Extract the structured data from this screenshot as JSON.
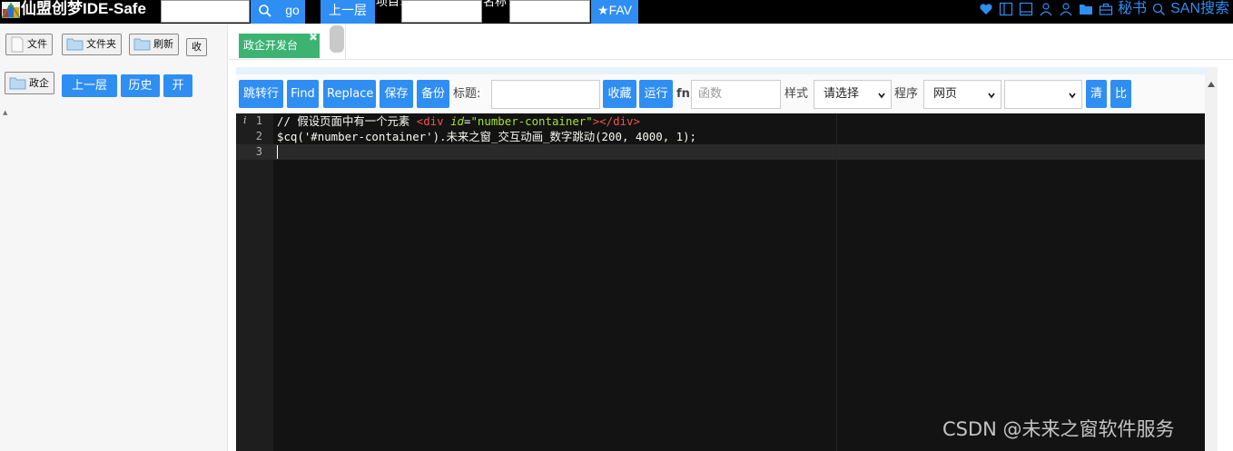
{
  "topbar": {
    "app_title": "仙盟创梦IDE-Safe",
    "search_value": "",
    "go_label": "go",
    "up_level_label": "上一层",
    "project_label": "项目:",
    "project_value": "",
    "name_label": "名称",
    "name_value": "",
    "fav_label": "★FAV",
    "secretary_label": "秘书",
    "san_search_label": "SAN搜索",
    "icons": [
      "heart-icon",
      "panel-left-icon",
      "panel-bottom-icon",
      "user-icon",
      "user-outline-icon",
      "folder-icon",
      "briefcase-icon"
    ]
  },
  "left_panel": {
    "file_label": "文件",
    "folder_label": "文件夹",
    "refresh_label": "刷新",
    "collapse_label": "收",
    "current_folder_label": "政企",
    "up_label": "上一层",
    "history_label": "历史",
    "open_label": "开"
  },
  "tabs": [
    {
      "label": "政企开发台",
      "active": true,
      "close": "✖"
    }
  ],
  "toolbar": {
    "goto_line_label": "跳转行",
    "find_label": "Find",
    "replace_label": "Replace",
    "save_label": "保存",
    "backup_label": "备份",
    "title_label": "标题:",
    "title_value": "",
    "collect_label": "收藏",
    "run_label": "运行",
    "fn_label": "fn",
    "function_placeholder": "函数",
    "style_label": "样式",
    "style_select_value": "请选择",
    "program_label": "程序",
    "program_select_value": "网页",
    "extra_select_value": "",
    "clear_label": "清",
    "compare_label": "比"
  },
  "editor": {
    "gutter_info": "i",
    "line_numbers": [
      "1",
      "2",
      "3"
    ],
    "line1": {
      "comment": "// 假设页面中有一个元素 ",
      "tag_open": "<div",
      "attr_name": "id",
      "eq": "=",
      "attr_value": "\"number-container\"",
      "tag_close": "></div>"
    },
    "line2": "$cq('#number-container').未来之窗_交互动画_数字跳动(200, 4000, 1);",
    "line3": ""
  },
  "watermark": "CSDN @未来之窗软件服务",
  "colors": {
    "accent": "#2f8ef2",
    "tab_active": "#3cb371",
    "editor_bg": "#131313",
    "html_tag": "#f0524f",
    "html_attr": "#a6e22e"
  }
}
